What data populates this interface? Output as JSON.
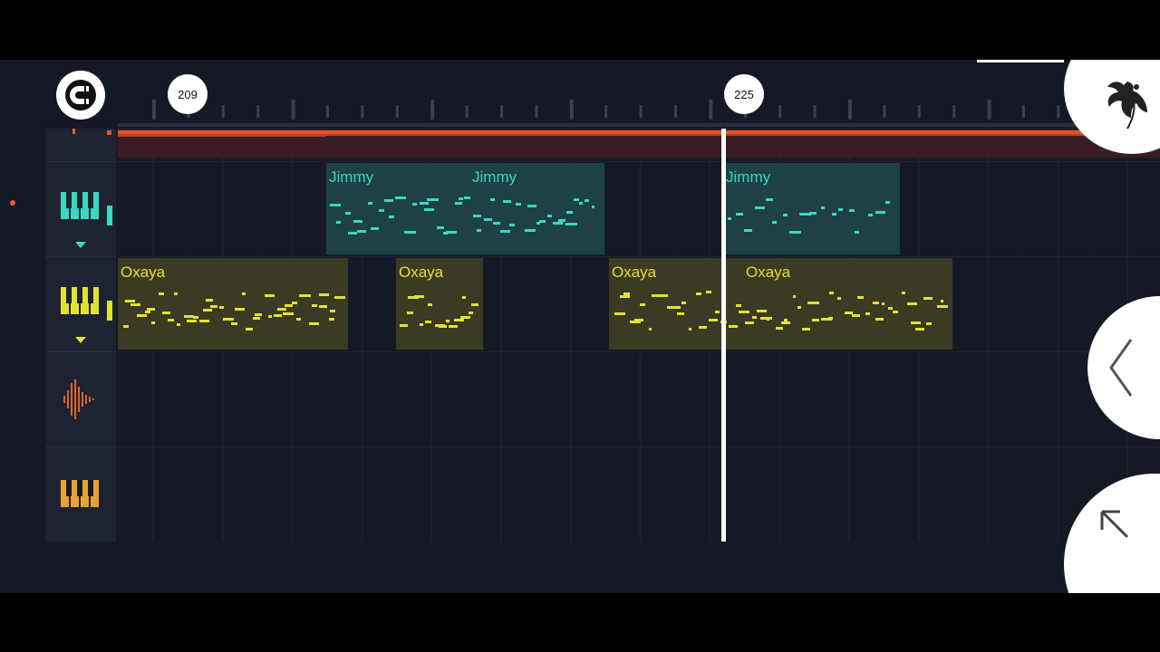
{
  "colors": {
    "background": "#151925",
    "jimmy": "#3ad8c1",
    "jimmy_clip": "#1d4146",
    "oxaya": "#e2e236",
    "oxaya_clip": "#3b3a22",
    "audio": "#e0622e",
    "keys": "#e9a232"
  },
  "timeline": {
    "markers": [
      {
        "label": "209",
        "bar": 209
      },
      {
        "label": "225",
        "bar": 225
      }
    ]
  },
  "tracks": [
    {
      "name": "jimmy-piano-track",
      "icon": "piano-keys-icon",
      "color": "#3ad8c1"
    },
    {
      "name": "oxaya-piano-track",
      "icon": "piano-keys-icon",
      "color": "#e2e236"
    },
    {
      "name": "audio-track",
      "icon": "audio-waveform-icon",
      "color": "#e0622e"
    },
    {
      "name": "keys-track",
      "icon": "piano-keys-icon",
      "color": "#e9a232"
    }
  ],
  "clips": {
    "jimmy": [
      {
        "label": "Jimmy"
      },
      {
        "label": "Jimmy"
      },
      {
        "label": "Jimmy"
      }
    ],
    "oxaya": [
      {
        "label": "Oxaya"
      },
      {
        "label": "Oxaya"
      },
      {
        "label": "Oxaya"
      },
      {
        "label": "Oxaya"
      }
    ]
  },
  "controls": {
    "magnet": "magnet-snap-icon",
    "logo": "fl-studio-fruit-logo",
    "back": "chevron-left-icon",
    "expand": "arrow-up-left-icon"
  }
}
